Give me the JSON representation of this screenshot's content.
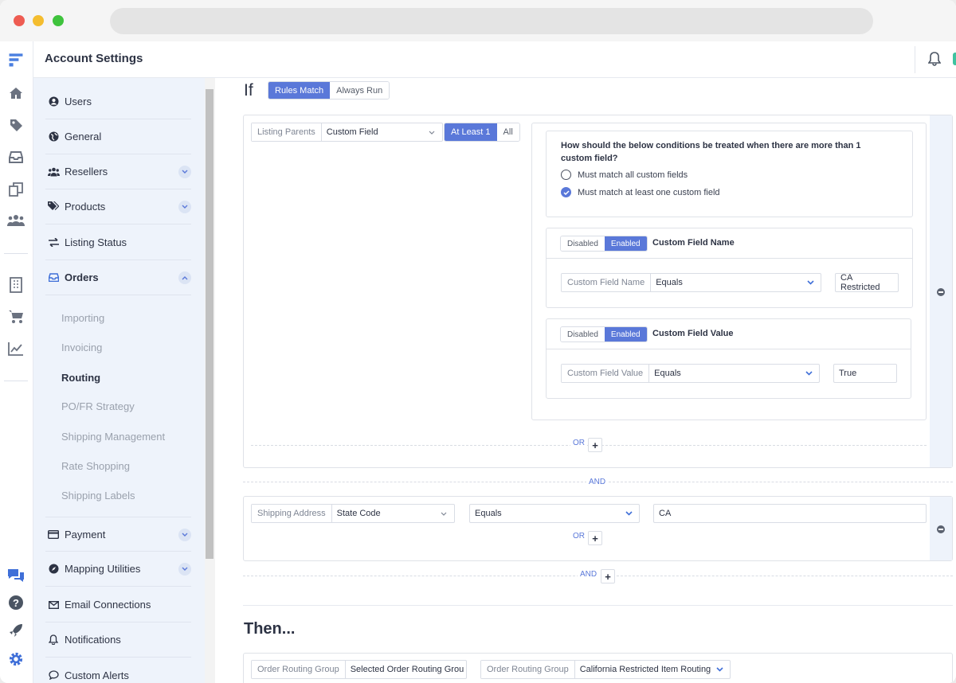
{
  "app": {
    "title": "Account Settings"
  },
  "sidebar": {
    "items": [
      {
        "label": "Users",
        "icon": "user-circle-icon"
      },
      {
        "label": "General",
        "icon": "globe-icon"
      },
      {
        "label": "Resellers",
        "icon": "users-icon"
      },
      {
        "label": "Products",
        "icon": "tags-icon"
      },
      {
        "label": "Listing Status",
        "icon": "exchange-icon"
      },
      {
        "label": "Orders",
        "icon": "inbox-icon"
      },
      {
        "label": "Payment",
        "icon": "credit-card-icon"
      },
      {
        "label": "Mapping Utilities",
        "icon": "compass-icon"
      },
      {
        "label": "Email Connections",
        "icon": "envelope-icon"
      },
      {
        "label": "Notifications",
        "icon": "bell-icon"
      },
      {
        "label": "Custom Alerts",
        "icon": "comment-icon"
      }
    ],
    "orders_sub": [
      "Importing",
      "Invoicing",
      "Routing",
      "PO/FR Strategy",
      "Shipping Management",
      "Rate Shopping",
      "Shipping Labels"
    ],
    "active_sub": "Routing"
  },
  "rule": {
    "if_label": "If",
    "mode_options": [
      "Rules Match",
      "Always Run"
    ],
    "mode_selected": "Rules Match",
    "group1": {
      "field_label": "Listing Parents",
      "field_value": "Custom Field",
      "quant_options": [
        "At Least 1",
        "All"
      ],
      "quant_selected": "At Least 1",
      "question": "How should the below conditions be treated when there are more than 1 custom field?",
      "radio_options": [
        "Must match all custom fields",
        "Must match at least one custom field"
      ],
      "radio_selected": 1,
      "toggle_options": [
        "Disabled",
        "Enabled"
      ],
      "name_title": "Custom Field Name",
      "name_label": "Custom Field Name",
      "name_op": "Equals",
      "name_value": "CA Restricted",
      "value_title": "Custom Field Value",
      "value_label": "Custom Field Value",
      "value_op": "Equals",
      "value_value": "True",
      "or_label": "OR"
    },
    "and_label": "AND",
    "group2": {
      "field_label": "Shipping Address",
      "field_value": "State Code",
      "op": "Equals",
      "value": "CA",
      "or_label": "OR"
    },
    "and2_label": "AND"
  },
  "then": {
    "heading": "Then...",
    "action1_label": "Order Routing Group",
    "action1_value": "Selected Order Routing Grou",
    "action2_label": "Order Routing Group",
    "action2_value": "California Restricted Item Routing"
  },
  "colors": {
    "accent": "#5a78d9",
    "sidebar_bg": "#eef3fb",
    "mac_red": "#ee5c52",
    "mac_yellow": "#f4bd2f",
    "mac_green": "#3fc33d"
  }
}
